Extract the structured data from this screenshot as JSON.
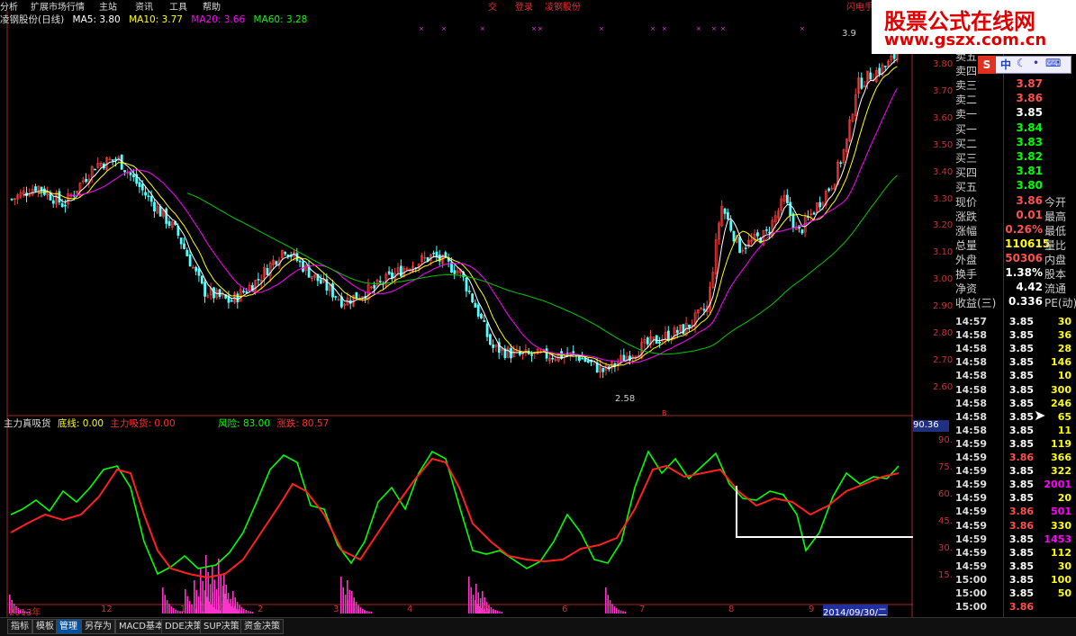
{
  "menubar": {
    "items": [
      "分析",
      "扩展市场行情",
      "主站",
      "资讯",
      "工具",
      "帮助"
    ],
    "center_items": [
      "交",
      "登录",
      "凌钢股份"
    ],
    "right_item": "闪电手"
  },
  "watermark": {
    "line1": "股票公式在线网",
    "line2": "www.gszx.com.cn"
  },
  "ime": {
    "label": "中",
    "icons": [
      "moon-icon",
      "dot-icon",
      "keyboard-icon"
    ]
  },
  "info_line": {
    "name": "凌钢股份(日线)",
    "ma5": "MA5: 3.80",
    "ma10": "MA10: 3.77",
    "ma20": "MA20: 3.66",
    "ma60": "MA60: 3.28",
    "colors": {
      "name": "#dddddd",
      "ma5": "#ffffff",
      "ma10": "#ffff00",
      "ma20": "#ff00ff",
      "ma60": "#00ff00"
    }
  },
  "price_axis": {
    "labels": [
      "3.80",
      "3.70",
      "3.60",
      "3.50",
      "3.40",
      "3.30",
      "3.20",
      "3.10",
      "3.00",
      "2.90",
      "2.80",
      "2.70",
      "2.60"
    ],
    "min": 2.55,
    "max": 3.92,
    "annot_high": "3.9",
    "annot_low": "2.58"
  },
  "indicator": {
    "name": "主力真吸货",
    "bottom_line": "底线: 0.00",
    "main_absorb": "主力吸货: 0.00",
    "risk": "风险: 83.00",
    "rise": "涨跌: 80.57",
    "current_value": "90.36",
    "axis_labels": [
      "90.00",
      "75.00",
      "60.00",
      "45.00",
      "30.00",
      "15.00"
    ]
  },
  "date_axis": {
    "labels": [
      "2013年",
      "12",
      "1",
      "2",
      "3",
      "4",
      "5",
      "6",
      "7",
      "8",
      "9"
    ],
    "current_date": "2014/09/30/二"
  },
  "quote": {
    "sell": [
      {
        "label": "卖五",
        "price": "",
        "color": "#ff5050"
      },
      {
        "label": "卖四",
        "price": "",
        "color": "#ff5050"
      },
      {
        "label": "卖三",
        "price": "3.87",
        "color": "#ff5050"
      },
      {
        "label": "卖二",
        "price": "3.86",
        "color": "#ff5050"
      },
      {
        "label": "卖一",
        "price": "3.85",
        "color": "#ffffff"
      }
    ],
    "buy": [
      {
        "label": "买一",
        "price": "3.84",
        "color": "#00ff00"
      },
      {
        "label": "买二",
        "price": "3.83",
        "color": "#00ff00"
      },
      {
        "label": "买三",
        "price": "3.82",
        "color": "#00ff00"
      },
      {
        "label": "买四",
        "price": "3.81",
        "color": "#00ff00"
      },
      {
        "label": "买五",
        "price": "3.80",
        "color": "#00ff00"
      }
    ],
    "stats": [
      {
        "label": "现价",
        "value": "3.86",
        "color": "#ff5050",
        "right": "今开"
      },
      {
        "label": "涨跌",
        "value": "0.01",
        "color": "#ff5050",
        "right": "最高"
      },
      {
        "label": "涨幅",
        "value": "0.26%",
        "color": "#ff5050",
        "right": "最低"
      },
      {
        "label": "总量",
        "value": "110615",
        "color": "#ffff00",
        "right": "量比"
      },
      {
        "label": "外盘",
        "value": "50306",
        "color": "#ff5050",
        "right": "内盘"
      },
      {
        "label": "换手",
        "value": "1.38%",
        "color": "#ffffff",
        "right": "股本"
      },
      {
        "label": "净资",
        "value": "4.42",
        "color": "#ffffff",
        "right": "流通"
      },
      {
        "label": "收益(三)",
        "value": "0.336",
        "color": "#ffffff",
        "right": "PE(动)"
      }
    ],
    "ticks": [
      {
        "time": "14:57",
        "price": "3.85",
        "vol": "30",
        "pc": "#ffffff",
        "vc": "#ffff00"
      },
      {
        "time": "14:58",
        "price": "3.85",
        "vol": "36",
        "pc": "#ffffff",
        "vc": "#ffff00"
      },
      {
        "time": "14:58",
        "price": "3.85",
        "vol": "28",
        "pc": "#ffffff",
        "vc": "#ffff00"
      },
      {
        "time": "14:58",
        "price": "3.85",
        "vol": "146",
        "pc": "#ffffff",
        "vc": "#ffff00"
      },
      {
        "time": "14:58",
        "price": "3.85",
        "vol": "10",
        "pc": "#ffffff",
        "vc": "#ffff00"
      },
      {
        "time": "14:58",
        "price": "3.85",
        "vol": "300",
        "pc": "#ffffff",
        "vc": "#ffff00"
      },
      {
        "time": "14:58",
        "price": "3.85",
        "vol": "246",
        "pc": "#ffffff",
        "vc": "#ffff00"
      },
      {
        "time": "14:58",
        "price": "3.85",
        "vol": "65",
        "pc": "#ffffff",
        "vc": "#ffff00"
      },
      {
        "time": "14:58",
        "price": "3.85",
        "vol": "11",
        "pc": "#ffffff",
        "vc": "#ffff00"
      },
      {
        "time": "14:59",
        "price": "3.85",
        "vol": "119",
        "pc": "#ffffff",
        "vc": "#ffff00"
      },
      {
        "time": "14:59",
        "price": "3.86",
        "vol": "366",
        "pc": "#ff5050",
        "vc": "#ffff00"
      },
      {
        "time": "14:59",
        "price": "3.85",
        "vol": "322",
        "pc": "#ffffff",
        "vc": "#ffff00"
      },
      {
        "time": "14:59",
        "price": "3.85",
        "vol": "2001",
        "pc": "#ffffff",
        "vc": "#ff00ff"
      },
      {
        "time": "14:59",
        "price": "3.85",
        "vol": "20",
        "pc": "#ffffff",
        "vc": "#ffff00"
      },
      {
        "time": "14:59",
        "price": "3.86",
        "vol": "501",
        "pc": "#ff5050",
        "vc": "#ff00ff"
      },
      {
        "time": "14:59",
        "price": "3.86",
        "vol": "330",
        "pc": "#ff5050",
        "vc": "#ffff00"
      },
      {
        "time": "14:59",
        "price": "3.85",
        "vol": "1453",
        "pc": "#ffffff",
        "vc": "#ff00ff"
      },
      {
        "time": "14:59",
        "price": "3.85",
        "vol": "112",
        "pc": "#ffffff",
        "vc": "#ffff00"
      },
      {
        "time": "14:59",
        "price": "3.85",
        "vol": "30",
        "pc": "#ffffff",
        "vc": "#ffff00"
      },
      {
        "time": "15:00",
        "price": "3.85",
        "vol": "100",
        "pc": "#ffffff",
        "vc": "#ffff00"
      },
      {
        "time": "15:00",
        "price": "3.85",
        "vol": "50",
        "pc": "#ffffff",
        "vc": "#ffff00"
      },
      {
        "time": "15:00",
        "price": "3.86",
        "vol": "",
        "pc": "#ff5050",
        "vc": "#ffff00"
      }
    ]
  },
  "bottom_tabs": [
    "指标",
    "模板",
    "管理",
    "另存为",
    "MACD基本",
    "DDE决策",
    "SUP决策",
    "资金决策"
  ],
  "bottom_tabs_active": 2
}
